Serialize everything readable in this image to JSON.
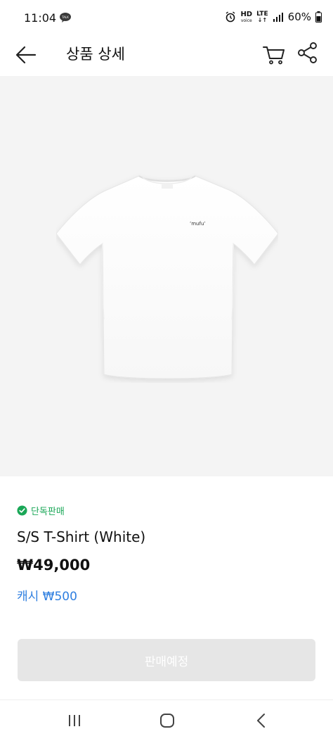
{
  "status_bar": {
    "time": "11:04",
    "talk_label": "TALK",
    "network_hd": "HD",
    "network_voice": "voice",
    "network_lte": "LTE",
    "battery": "60%"
  },
  "header": {
    "title": "상품 상세"
  },
  "product": {
    "image_icon": "tshirt-image",
    "shirt_logo_text": "ʻmufuʼ",
    "badge_label": "단독판매",
    "name": "S/S T-Shirt (White)",
    "price": "₩49,000",
    "cash_reward": "캐시 ₩500"
  },
  "cta": {
    "label": "판매예정"
  },
  "colors": {
    "badge_green": "#1aa757",
    "cash_blue": "#2f7fe0",
    "image_bg": "#f4f4f4",
    "cta_bg": "#e6e6e6"
  },
  "icons": {
    "back": "arrow-left-icon",
    "cart": "cart-icon",
    "share": "share-icon",
    "badge": "check-circle-icon",
    "nav_recents": "recents-icon",
    "nav_home": "home-icon",
    "nav_back": "chevron-left-icon"
  }
}
